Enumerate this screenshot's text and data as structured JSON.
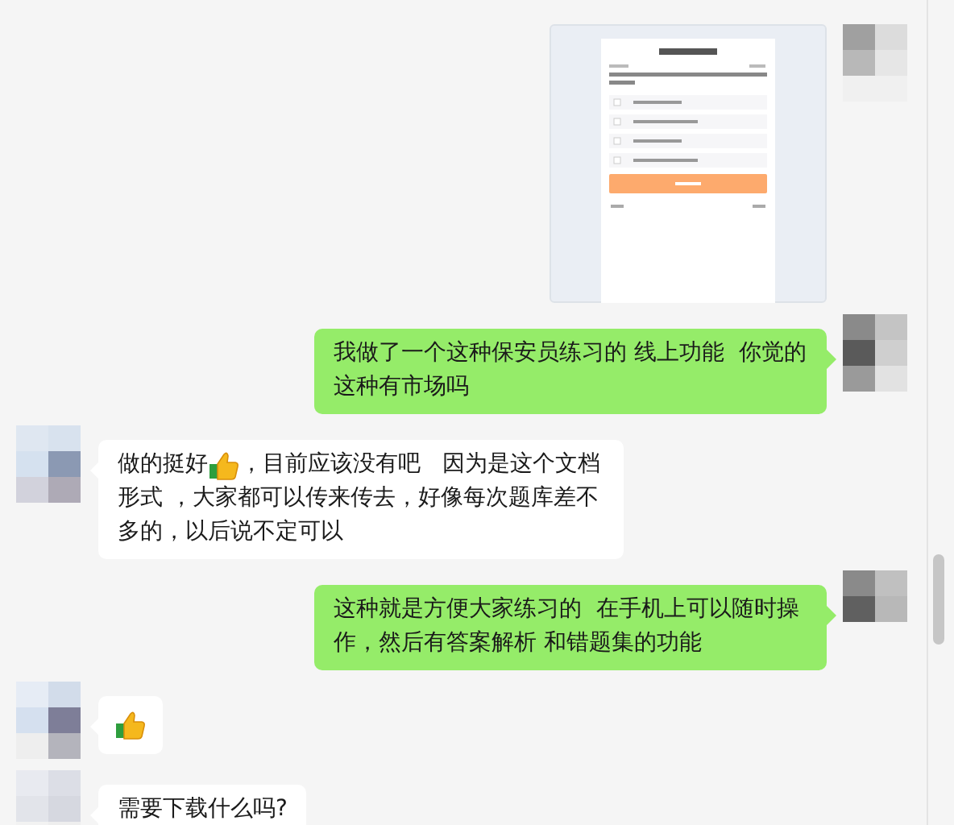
{
  "messages": [
    {
      "kind": "image"
    },
    {
      "outgoing": true,
      "kind": "text",
      "text": "我做了一个这种保安员练习的 线上功能  你觉的这种有市场吗"
    },
    {
      "outgoing": false,
      "kind": "rich",
      "parts": [
        {
          "kind": "text",
          "text": "做的挺好"
        },
        {
          "kind": "emoji"
        },
        {
          "kind": "text",
          "text": "，目前应该没有吧   因为是这个文档"
        },
        {
          "kind": "wrap",
          "text": "形式 ，大家都可以传来传去，好像每次题库差不多的，以后说不定可以"
        }
      ]
    },
    {
      "outgoing": true,
      "kind": "text",
      "text": "这种就是方便大家练习的  在手机上可以随时操作，然后有答案解析 和错题集的功能"
    },
    {
      "outgoing": false,
      "kind": "emoji"
    },
    {
      "outgoing": false,
      "kind": "text",
      "text": "需要下载什么吗?"
    }
  ]
}
